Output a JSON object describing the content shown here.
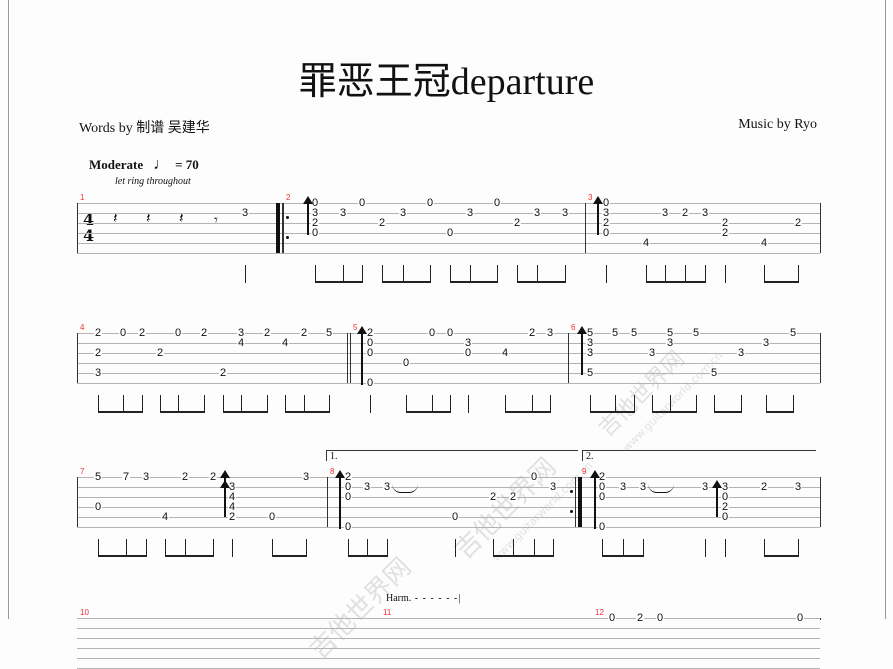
{
  "title": "罪恶王冠departure",
  "words_by": "Words by  制谱 吴建华",
  "music_by": "Music by Ryo",
  "tempo": {
    "label": "Moderate",
    "note_icon": "quarter-note-icon",
    "glyph": "♩",
    "value": "= 70"
  },
  "let_ring": "let ring throughout",
  "time_signature": {
    "top": "4",
    "bottom": "4"
  },
  "harm_label": "Harm.",
  "watermark": {
    "cn": "吉他世界网",
    "url": "www.guitarworld.com.cn"
  },
  "voltas": [
    "1.",
    "2."
  ],
  "rest_glyphs": {
    "quarter": "𝄽",
    "eighth": "𝄾"
  },
  "measures": [
    {
      "number": "1",
      "beats": [
        [
          {
            "s": 2,
            "f": "3"
          }
        ]
      ]
    },
    {
      "number": "2",
      "beats": [
        [
          {
            "s": 1,
            "f": "0"
          },
          {
            "s": 2,
            "f": "3"
          },
          {
            "s": 3,
            "f": "2"
          },
          {
            "s": 4,
            "f": "0"
          }
        ],
        [
          {
            "s": 2,
            "f": "3"
          }
        ],
        [
          {
            "s": 1,
            "f": "0"
          }
        ],
        [
          {
            "s": 3,
            "f": "2"
          }
        ],
        [
          {
            "s": 2,
            "f": "3"
          }
        ],
        [
          {
            "s": 1,
            "f": "0"
          }
        ],
        [
          {
            "s": 4,
            "f": "0"
          }
        ],
        [
          {
            "s": 2,
            "f": "3"
          }
        ],
        [
          {
            "s": 1,
            "f": "0"
          }
        ],
        [
          {
            "s": 3,
            "f": "2"
          }
        ],
        [
          {
            "s": 2,
            "f": "3"
          }
        ],
        [
          {
            "s": 2,
            "f": "3"
          }
        ]
      ]
    },
    {
      "number": "3",
      "beats": [
        [
          {
            "s": 1,
            "f": "0"
          },
          {
            "s": 2,
            "f": "3"
          },
          {
            "s": 3,
            "f": "2"
          },
          {
            "s": 4,
            "f": "0"
          }
        ],
        [
          {
            "s": 5,
            "f": "4"
          }
        ],
        [
          {
            "s": 2,
            "f": "3"
          }
        ],
        [
          {
            "s": 2,
            "f": "2"
          }
        ],
        [
          {
            "s": 2,
            "f": "3"
          }
        ],
        [
          {
            "s": 3,
            "f": "2"
          },
          {
            "s": 4,
            "f": "2"
          }
        ],
        [
          {
            "s": 5,
            "f": "4"
          }
        ],
        [
          {
            "s": 3,
            "f": "2"
          }
        ]
      ]
    },
    {
      "number": "4",
      "beats": [
        [
          {
            "s": 1,
            "f": "2"
          },
          {
            "s": 3,
            "f": "2"
          },
          {
            "s": 5,
            "f": "3"
          }
        ],
        [
          {
            "s": 1,
            "f": "0"
          }
        ],
        [
          {
            "s": 1,
            "f": "2"
          }
        ],
        [
          {
            "s": 3,
            "f": "2"
          }
        ],
        [
          {
            "s": 1,
            "f": "0"
          }
        ],
        [
          {
            "s": 1,
            "f": "2"
          }
        ],
        [
          {
            "s": 5,
            "f": "2"
          }
        ],
        [
          {
            "s": 1,
            "f": "3"
          },
          {
            "s": 2,
            "f": "4"
          }
        ],
        [
          {
            "s": 1,
            "f": "2"
          }
        ],
        [
          {
            "s": 2,
            "f": "4"
          }
        ],
        [
          {
            "s": 1,
            "f": "2"
          }
        ],
        [
          {
            "s": 1,
            "f": "5"
          }
        ]
      ]
    },
    {
      "number": "5",
      "beats": [
        [
          {
            "s": 1,
            "f": "2"
          },
          {
            "s": 2,
            "f": "0"
          },
          {
            "s": 3,
            "f": "0"
          },
          {
            "s": 6,
            "f": "0"
          }
        ],
        [
          {
            "s": 4,
            "f": "0"
          }
        ],
        [
          {
            "s": 1,
            "f": "0"
          }
        ],
        [
          {
            "s": 1,
            "f": "0"
          }
        ],
        [
          {
            "s": 2,
            "f": "3"
          },
          {
            "s": 3,
            "f": "0"
          }
        ],
        [
          {
            "s": 3,
            "f": "4"
          }
        ],
        [
          {
            "s": 1,
            "f": "2"
          }
        ],
        [
          {
            "s": 1,
            "f": "3"
          }
        ]
      ]
    },
    {
      "number": "6",
      "beats": [
        [
          {
            "s": 1,
            "f": "5"
          },
          {
            "s": 2,
            "f": "3"
          },
          {
            "s": 3,
            "f": "3"
          },
          {
            "s": 5,
            "f": "5"
          }
        ],
        [
          {
            "s": 1,
            "f": "5"
          }
        ],
        [
          {
            "s": 1,
            "f": "5"
          }
        ],
        [
          {
            "s": 3,
            "f": "3"
          }
        ],
        [
          {
            "s": 1,
            "f": "5"
          },
          {
            "s": 2,
            "f": "3"
          }
        ],
        [
          {
            "s": 1,
            "f": "5"
          }
        ],
        [
          {
            "s": 5,
            "f": "5"
          }
        ],
        [
          {
            "s": 3,
            "f": "3"
          }
        ],
        [
          {
            "s": 2,
            "f": "3"
          }
        ],
        [
          {
            "s": 1,
            "f": "5"
          }
        ]
      ]
    },
    {
      "number": "7",
      "beats": [
        [
          {
            "s": 1,
            "f": "5"
          },
          {
            "s": 4,
            "f": "0"
          }
        ],
        [
          {
            "s": 1,
            "f": "7"
          }
        ],
        [
          {
            "s": 1,
            "f": "3"
          }
        ],
        [
          {
            "s": 5,
            "f": "4"
          }
        ],
        [
          {
            "s": 1,
            "f": "2"
          }
        ],
        [
          {
            "s": 1,
            "f": "2"
          }
        ],
        [
          {
            "s": 2,
            "f": "3"
          },
          {
            "s": 3,
            "f": "4"
          },
          {
            "s": 4,
            "f": "4"
          },
          {
            "s": 5,
            "f": "2"
          }
        ],
        [
          {
            "s": 5,
            "f": "0"
          }
        ],
        [
          {
            "s": 1,
            "f": "3"
          }
        ]
      ]
    },
    {
      "number": "8",
      "beats": [
        [
          {
            "s": 1,
            "f": "2"
          },
          {
            "s": 2,
            "f": "0"
          },
          {
            "s": 3,
            "f": "0"
          },
          {
            "s": 6,
            "f": "0"
          }
        ],
        [
          {
            "s": 2,
            "f": "3"
          }
        ],
        [
          {
            "s": 2,
            "f": "3"
          }
        ],
        [
          {
            "s": 5,
            "f": "0"
          }
        ],
        [
          {
            "s": 3,
            "f": "2"
          }
        ],
        [
          {
            "s": 3,
            "f": "2"
          }
        ],
        [
          {
            "s": 1,
            "f": "0"
          }
        ],
        [
          {
            "s": 2,
            "f": "3"
          }
        ]
      ]
    },
    {
      "number": "9",
      "beats": [
        [
          {
            "s": 1,
            "f": "2"
          },
          {
            "s": 2,
            "f": "0"
          },
          {
            "s": 3,
            "f": "0"
          },
          {
            "s": 6,
            "f": "0"
          }
        ],
        [
          {
            "s": 2,
            "f": "3"
          }
        ],
        [
          {
            "s": 2,
            "f": "3"
          }
        ],
        [
          {
            "s": 2,
            "f": "3"
          }
        ],
        [
          {
            "s": 2,
            "f": "3"
          },
          {
            "s": 3,
            "f": "0"
          },
          {
            "s": 4,
            "f": "2"
          },
          {
            "s": 5,
            "f": "0"
          }
        ],
        [
          {
            "s": 2,
            "f": "2"
          }
        ],
        [
          {
            "s": 2,
            "f": "3"
          }
        ]
      ]
    },
    {
      "number": "10",
      "beats": []
    },
    {
      "number": "11",
      "beats": []
    },
    {
      "number": "12",
      "beats": [
        [
          {
            "s": 1,
            "f": "0"
          }
        ],
        [
          {
            "s": 1,
            "f": "2"
          }
        ],
        [
          {
            "s": 1,
            "f": "0"
          }
        ],
        [
          {
            "s": 1,
            "f": "0"
          }
        ]
      ]
    }
  ]
}
